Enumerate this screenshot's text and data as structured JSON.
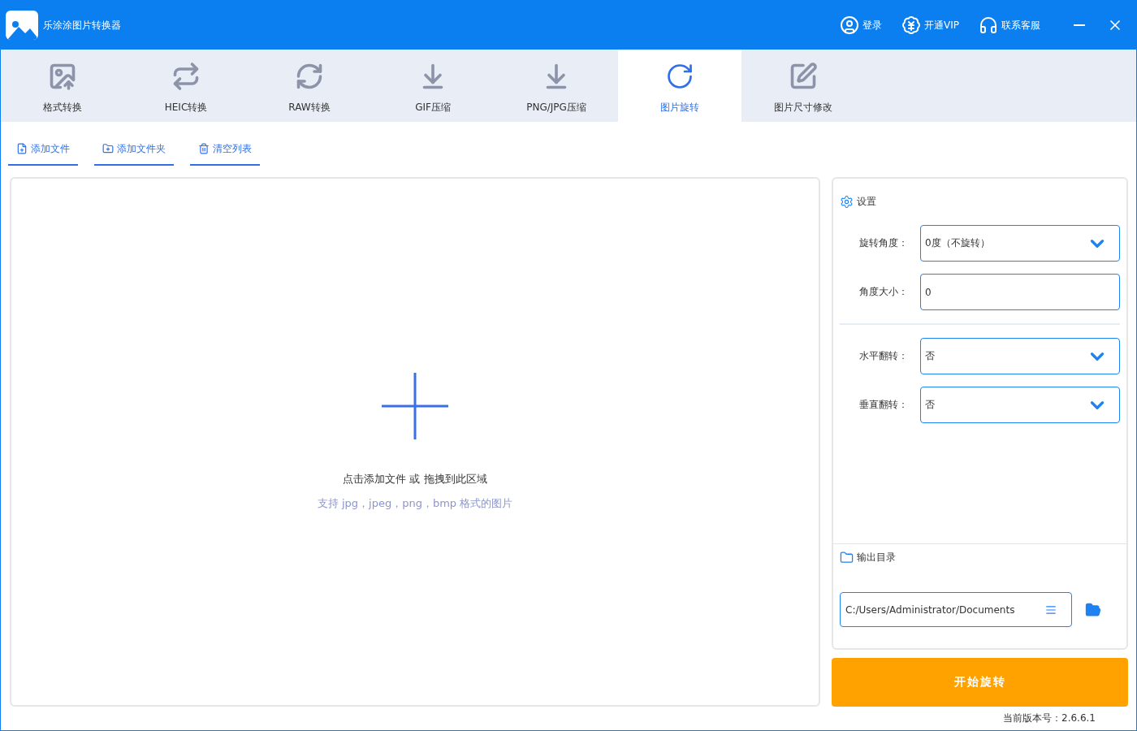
{
  "window": {
    "title": "乐涂涂图片转换器"
  },
  "header_actions": [
    {
      "kind": "user",
      "label": "登录"
    },
    {
      "kind": "vip",
      "label": "开通VIP"
    },
    {
      "kind": "support",
      "label": "联系客服"
    }
  ],
  "tabs": [
    {
      "kind": "format",
      "label": "格式转换",
      "selected": false
    },
    {
      "kind": "heic",
      "label": "HEIC转换",
      "selected": false
    },
    {
      "kind": "raw",
      "label": "RAW转换",
      "selected": false
    },
    {
      "kind": "gif",
      "label": "GIF压缩",
      "selected": false
    },
    {
      "kind": "png",
      "label": "PNG/JPG压缩",
      "selected": false
    },
    {
      "kind": "rotate",
      "label": "图片旋转",
      "selected": true
    },
    {
      "kind": "resize",
      "label": "图片尺寸修改",
      "selected": false
    }
  ],
  "toolbar": [
    {
      "kind": "file",
      "label": "添加文件"
    },
    {
      "kind": "folder",
      "label": "添加文件夹"
    },
    {
      "kind": "clear",
      "label": "清空列表"
    }
  ],
  "drop_zone": {
    "prompt": "点击添加文件 或 拖拽到此区域",
    "hint": "支持 jpg，jpeg，png，bmp 格式的图片"
  },
  "settings": {
    "title": "设置",
    "groups": [
      [
        {
          "kind": "select",
          "label": "旋转角度：",
          "value": "0度（不旋转）"
        },
        {
          "kind": "input",
          "label": "角度大小：",
          "value": "0"
        }
      ],
      [
        {
          "kind": "select",
          "label": "水平翻转：",
          "value": "否"
        },
        {
          "kind": "select",
          "label": "垂直翻转：",
          "value": "否"
        }
      ]
    ]
  },
  "output": {
    "title": "输出目录",
    "path": "C:/Users/Administrator/Documents"
  },
  "start_button": "开始旋转",
  "version": "当前版本号：2.6.6.1"
}
